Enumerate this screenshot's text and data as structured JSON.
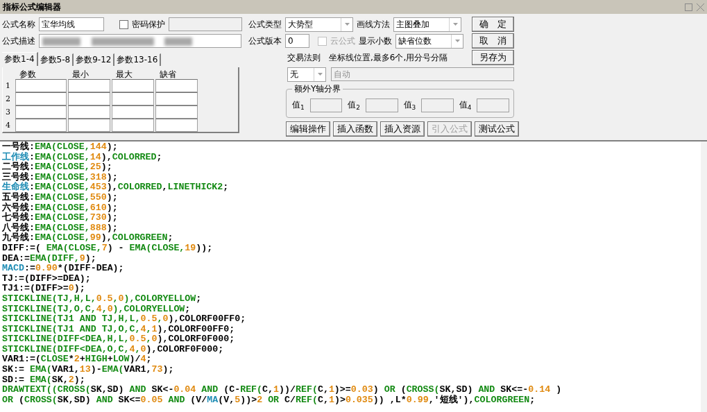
{
  "window": {
    "title": "指标公式编辑器"
  },
  "name_field": {
    "label": "公式名称",
    "value": "宝华均线"
  },
  "password": {
    "label": "密码保护",
    "checked": false
  },
  "description_field": {
    "label": "公式描述",
    "redacted": true
  },
  "param_tabs": [
    {
      "label": "参数1-4",
      "selected": true
    },
    {
      "label": "参数5-8",
      "selected": false
    },
    {
      "label": "参数9-12",
      "selected": false
    },
    {
      "label": "参数13-16",
      "selected": false
    }
  ],
  "param_table": {
    "columns": [
      "参数",
      "最小",
      "最大",
      "缺省"
    ],
    "rows": [
      "1",
      "2",
      "3",
      "4"
    ]
  },
  "formula_type": {
    "label": "公式类型",
    "value": "大势型"
  },
  "draw_method": {
    "label": "画线方法",
    "value": "主图叠加"
  },
  "version": {
    "label": "公式版本",
    "value": "0"
  },
  "cloud_formula": {
    "label": "云公式",
    "checked": false,
    "disabled": true
  },
  "decimals": {
    "label": "显示小数",
    "value": "缺省位数"
  },
  "trade_rule": {
    "label": "交易法则",
    "value": "无"
  },
  "axis_lines": {
    "label": "坐标线位置,最多6个,用分号分隔",
    "placeholder": "自动"
  },
  "y_axis_group": {
    "title": "额外Y轴分界",
    "fields": [
      {
        "label": "值",
        "index": "1"
      },
      {
        "label": "值",
        "index": "2"
      },
      {
        "label": "值",
        "index": "3"
      },
      {
        "label": "值",
        "index": "4"
      }
    ]
  },
  "side_buttons": [
    {
      "label": "确　定"
    },
    {
      "label": "取　消"
    },
    {
      "label": "另存为"
    }
  ],
  "action_buttons": [
    {
      "label": "编辑操作",
      "disabled": false
    },
    {
      "label": "插入函数",
      "disabled": false
    },
    {
      "label": "插入资源",
      "disabled": false
    },
    {
      "label": "引入公式",
      "disabled": true
    },
    {
      "label": "测试公式",
      "disabled": false
    }
  ],
  "code_lines": [
    [
      {
        "kind": "plain",
        "text": "一号线:"
      },
      {
        "kind": "func",
        "text": "EMA(CLOSE,"
      },
      {
        "kind": "num",
        "text": "144"
      },
      {
        "kind": "plain",
        "text": ");"
      }
    ],
    [
      {
        "kind": "name",
        "text": "工作线"
      },
      {
        "kind": "plain",
        "text": ":"
      },
      {
        "kind": "func",
        "text": "EMA(CLOSE,"
      },
      {
        "kind": "num",
        "text": "14"
      },
      {
        "kind": "plain",
        "text": "),"
      },
      {
        "kind": "func",
        "text": "COLORRED"
      },
      {
        "kind": "plain",
        "text": ";"
      }
    ],
    [
      {
        "kind": "plain",
        "text": "二号线:"
      },
      {
        "kind": "func",
        "text": "EMA(CLOSE,"
      },
      {
        "kind": "num",
        "text": "25"
      },
      {
        "kind": "plain",
        "text": ");"
      }
    ],
    [
      {
        "kind": "plain",
        "text": "三号线:"
      },
      {
        "kind": "func",
        "text": "EMA(CLOSE,"
      },
      {
        "kind": "num",
        "text": "318"
      },
      {
        "kind": "plain",
        "text": ");"
      }
    ],
    [
      {
        "kind": "name",
        "text": "生命线"
      },
      {
        "kind": "plain",
        "text": ":"
      },
      {
        "kind": "func",
        "text": "EMA(CLOSE,"
      },
      {
        "kind": "num",
        "text": "453"
      },
      {
        "kind": "plain",
        "text": "),"
      },
      {
        "kind": "func",
        "text": "COLORRED"
      },
      {
        "kind": "plain",
        "text": ","
      },
      {
        "kind": "func",
        "text": "LINETHICK2"
      },
      {
        "kind": "plain",
        "text": ";"
      }
    ],
    [
      {
        "kind": "plain",
        "text": "五号线:"
      },
      {
        "kind": "func",
        "text": "EMA(CLOSE,"
      },
      {
        "kind": "num",
        "text": "550"
      },
      {
        "kind": "plain",
        "text": ");"
      }
    ],
    [
      {
        "kind": "plain",
        "text": "六号线:"
      },
      {
        "kind": "func",
        "text": "EMA(CLOSE,"
      },
      {
        "kind": "num",
        "text": "610"
      },
      {
        "kind": "plain",
        "text": ");"
      }
    ],
    [
      {
        "kind": "plain",
        "text": "七号线:"
      },
      {
        "kind": "func",
        "text": "EMA(CLOSE,"
      },
      {
        "kind": "num",
        "text": "730"
      },
      {
        "kind": "plain",
        "text": ");"
      }
    ],
    [
      {
        "kind": "plain",
        "text": "八号线:"
      },
      {
        "kind": "func",
        "text": "EMA(CLOSE,"
      },
      {
        "kind": "num",
        "text": "888"
      },
      {
        "kind": "plain",
        "text": ");"
      }
    ],
    [
      {
        "kind": "plain",
        "text": "九号线:"
      },
      {
        "kind": "func",
        "text": "EMA(CLOSE,"
      },
      {
        "kind": "num",
        "text": "99"
      },
      {
        "kind": "plain",
        "text": "),"
      },
      {
        "kind": "func",
        "text": "COLORGREEN"
      },
      {
        "kind": "plain",
        "text": ";"
      }
    ],
    [
      {
        "kind": "plain",
        "text": "DIFF:=( "
      },
      {
        "kind": "func",
        "text": "EMA(CLOSE,"
      },
      {
        "kind": "num",
        "text": "7"
      },
      {
        "kind": "plain",
        "text": ") - "
      },
      {
        "kind": "func",
        "text": "EMA(CLOSE,"
      },
      {
        "kind": "num",
        "text": "19"
      },
      {
        "kind": "plain",
        "text": "));"
      }
    ],
    [
      {
        "kind": "plain",
        "text": "DEA:="
      },
      {
        "kind": "func",
        "text": "EMA(DIFF,"
      },
      {
        "kind": "num",
        "text": "9"
      },
      {
        "kind": "plain",
        "text": ");"
      }
    ],
    [
      {
        "kind": "name",
        "text": "MACD"
      },
      {
        "kind": "plain",
        "text": ":="
      },
      {
        "kind": "num",
        "text": "0.90"
      },
      {
        "kind": "plain",
        "text": "*(DIFF-DEA);"
      }
    ],
    [
      {
        "kind": "plain",
        "text": "TJ:=(DIFF>=DEA);"
      }
    ],
    [
      {
        "kind": "plain",
        "text": "TJ1:=(DIFF>="
      },
      {
        "kind": "num",
        "text": "0"
      },
      {
        "kind": "plain",
        "text": ");"
      }
    ],
    [
      {
        "kind": "func",
        "text": "STICKLINE(TJ,H,L,"
      },
      {
        "kind": "num",
        "text": "0.5"
      },
      {
        "kind": "func",
        "text": ","
      },
      {
        "kind": "num",
        "text": "0"
      },
      {
        "kind": "func",
        "text": "),COLORYELLOW"
      },
      {
        "kind": "plain",
        "text": ";"
      }
    ],
    [
      {
        "kind": "func",
        "text": "STICKLINE(TJ,O,C,"
      },
      {
        "kind": "num",
        "text": "4"
      },
      {
        "kind": "func",
        "text": ","
      },
      {
        "kind": "num",
        "text": "0"
      },
      {
        "kind": "func",
        "text": "),COLORYELLOW"
      },
      {
        "kind": "plain",
        "text": ";"
      }
    ],
    [
      {
        "kind": "func",
        "text": "STICKLINE(TJ1 AND TJ,H,L,"
      },
      {
        "kind": "num",
        "text": "0.5"
      },
      {
        "kind": "func",
        "text": ","
      },
      {
        "kind": "num",
        "text": "0"
      },
      {
        "kind": "plain",
        "text": "),COLORF00FF0;"
      }
    ],
    [
      {
        "kind": "func",
        "text": "STICKLINE(TJ1 AND TJ,O,C,"
      },
      {
        "kind": "num",
        "text": "4"
      },
      {
        "kind": "func",
        "text": ","
      },
      {
        "kind": "num",
        "text": "1"
      },
      {
        "kind": "plain",
        "text": "),COLORF00FF0;"
      }
    ],
    [
      {
        "kind": "func",
        "text": "STICKLINE(DIFF<DEA,H,L,"
      },
      {
        "kind": "num",
        "text": "0.5"
      },
      {
        "kind": "func",
        "text": ","
      },
      {
        "kind": "num",
        "text": "0"
      },
      {
        "kind": "plain",
        "text": "),COLORF0F000;"
      }
    ],
    [
      {
        "kind": "func",
        "text": "STICKLINE(DIFF<DEA,O,C,"
      },
      {
        "kind": "num",
        "text": "4"
      },
      {
        "kind": "func",
        "text": ","
      },
      {
        "kind": "num",
        "text": "0"
      },
      {
        "kind": "plain",
        "text": "),COLORF0F000;"
      }
    ],
    [
      {
        "kind": "plain",
        "text": "VAR1:=("
      },
      {
        "kind": "func",
        "text": "CLOSE"
      },
      {
        "kind": "plain",
        "text": "*"
      },
      {
        "kind": "num",
        "text": "2"
      },
      {
        "kind": "plain",
        "text": "+"
      },
      {
        "kind": "func",
        "text": "HIGH"
      },
      {
        "kind": "plain",
        "text": "+"
      },
      {
        "kind": "func",
        "text": "LOW"
      },
      {
        "kind": "plain",
        "text": ")/"
      },
      {
        "kind": "num",
        "text": "4"
      },
      {
        "kind": "plain",
        "text": ";"
      }
    ],
    [
      {
        "kind": "plain",
        "text": "SK:= "
      },
      {
        "kind": "func",
        "text": "EMA("
      },
      {
        "kind": "plain",
        "text": "VAR1,"
      },
      {
        "kind": "num",
        "text": "13"
      },
      {
        "kind": "plain",
        "text": ")-"
      },
      {
        "kind": "func",
        "text": "EMA("
      },
      {
        "kind": "plain",
        "text": "VAR1,"
      },
      {
        "kind": "num",
        "text": "73"
      },
      {
        "kind": "plain",
        "text": ");"
      }
    ],
    [
      {
        "kind": "plain",
        "text": "SD:= "
      },
      {
        "kind": "func",
        "text": "EMA("
      },
      {
        "kind": "plain",
        "text": "SK,"
      },
      {
        "kind": "num",
        "text": "2"
      },
      {
        "kind": "plain",
        "text": ");"
      }
    ],
    [
      {
        "kind": "func",
        "text": "DRAWTEXT((CROSS("
      },
      {
        "kind": "plain",
        "text": "SK,SD) "
      },
      {
        "kind": "func",
        "text": "AND"
      },
      {
        "kind": "plain",
        "text": " SK<-"
      },
      {
        "kind": "num",
        "text": "0.04"
      },
      {
        "kind": "func",
        "text": " AND"
      },
      {
        "kind": "plain",
        "text": " (C-"
      },
      {
        "kind": "func",
        "text": "REF("
      },
      {
        "kind": "plain",
        "text": "C,"
      },
      {
        "kind": "num",
        "text": "1"
      },
      {
        "kind": "plain",
        "text": "))/"
      },
      {
        "kind": "func",
        "text": "REF("
      },
      {
        "kind": "plain",
        "text": "C,"
      },
      {
        "kind": "num",
        "text": "1"
      },
      {
        "kind": "plain",
        "text": ")>="
      },
      {
        "kind": "num",
        "text": "0.03"
      },
      {
        "kind": "plain",
        "text": ") "
      },
      {
        "kind": "func",
        "text": "OR"
      },
      {
        "kind": "plain",
        "text": " ("
      },
      {
        "kind": "func",
        "text": "CROSS("
      },
      {
        "kind": "plain",
        "text": "SK,SD) "
      },
      {
        "kind": "func",
        "text": "AND"
      },
      {
        "kind": "plain",
        "text": " SK<=-"
      },
      {
        "kind": "num",
        "text": "0.14"
      },
      {
        "kind": "plain",
        "text": " )"
      }
    ],
    [
      {
        "kind": "func",
        "text": "OR"
      },
      {
        "kind": "plain",
        "text": " ("
      },
      {
        "kind": "func",
        "text": "CROSS("
      },
      {
        "kind": "plain",
        "text": "SK,SD) "
      },
      {
        "kind": "func",
        "text": "AND"
      },
      {
        "kind": "plain",
        "text": " SK<="
      },
      {
        "kind": "num",
        "text": "0.05"
      },
      {
        "kind": "func",
        "text": " AND"
      },
      {
        "kind": "plain",
        "text": " (V/"
      },
      {
        "kind": "name",
        "text": "MA"
      },
      {
        "kind": "plain",
        "text": "(V,"
      },
      {
        "kind": "num",
        "text": "5"
      },
      {
        "kind": "plain",
        "text": "))>"
      },
      {
        "kind": "num",
        "text": "2"
      },
      {
        "kind": "func",
        "text": " OR"
      },
      {
        "kind": "plain",
        "text": " C/"
      },
      {
        "kind": "func",
        "text": "REF("
      },
      {
        "kind": "plain",
        "text": "C,"
      },
      {
        "kind": "num",
        "text": "1"
      },
      {
        "kind": "plain",
        "text": ")>"
      },
      {
        "kind": "num",
        "text": "0.035"
      },
      {
        "kind": "plain",
        "text": ")) ,L*"
      },
      {
        "kind": "num",
        "text": "0.99"
      },
      {
        "kind": "plain",
        "text": ",'短线'),"
      },
      {
        "kind": "func",
        "text": "COLORGREEN"
      },
      {
        "kind": "plain",
        "text": ";"
      }
    ]
  ]
}
